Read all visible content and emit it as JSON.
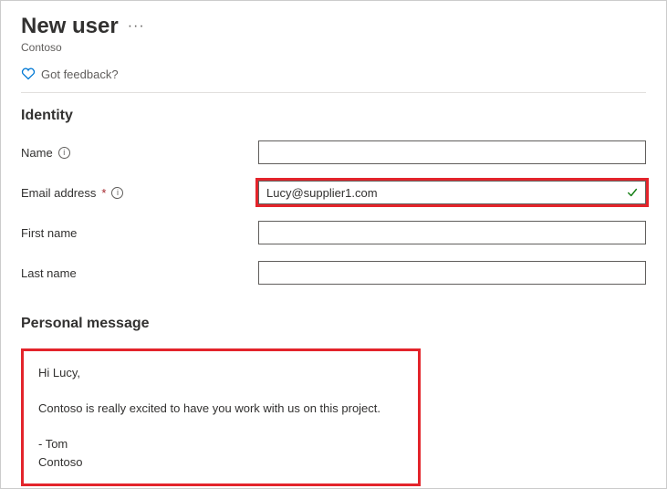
{
  "header": {
    "title": "New user",
    "subtitle": "Contoso",
    "feedback_label": "Got feedback?"
  },
  "identity": {
    "section_title": "Identity",
    "name_label": "Name",
    "name_value": "",
    "email_label": "Email address",
    "email_value": "Lucy@supplier1.com",
    "email_valid": true,
    "firstname_label": "First name",
    "firstname_value": "",
    "lastname_label": "Last name",
    "lastname_value": ""
  },
  "personal_message": {
    "section_title": "Personal message",
    "text": "Hi Lucy,\n\nContoso is really excited to have you work with us on this project.\n\n- Tom\nContoso"
  }
}
